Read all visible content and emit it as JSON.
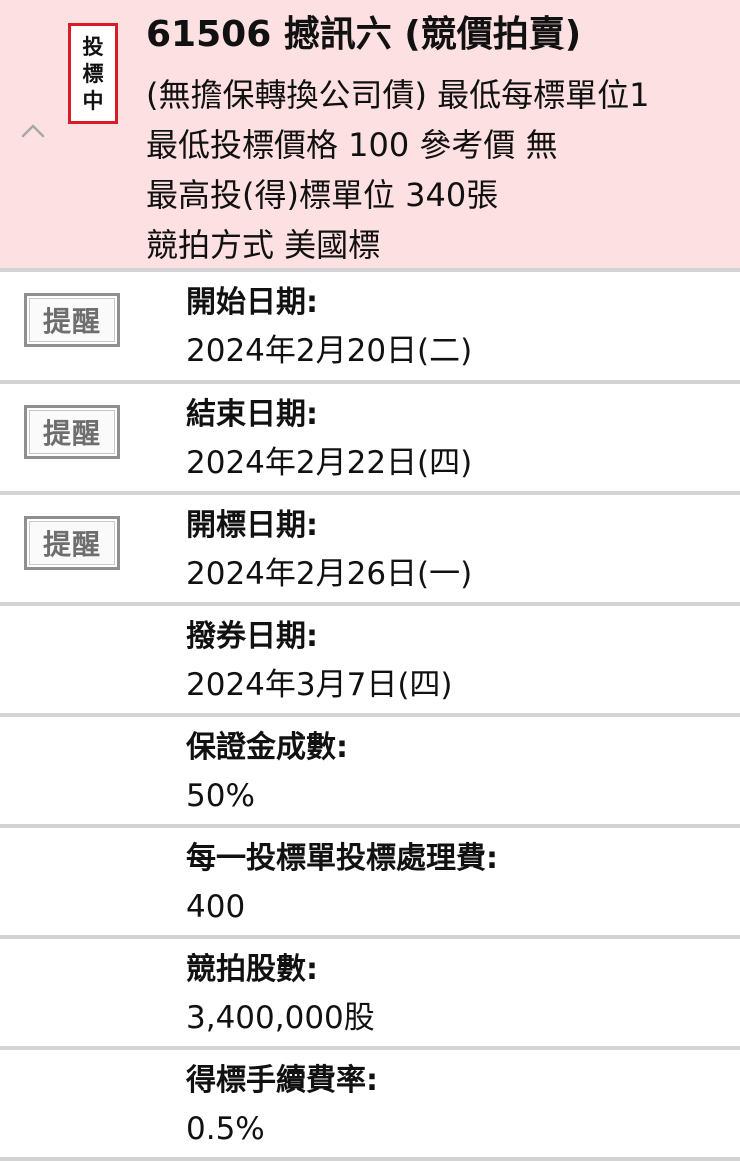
{
  "auction": {
    "status_stamp": [
      "投",
      "標",
      "中"
    ],
    "title": "61506 撼訊六 (競價拍賣)",
    "bond_type_line": "(無擔保轉換公司債) 最低每標單位1",
    "min_price_line": "最低投標價格 100 參考價 無",
    "max_units_line": "最高投(得)標單位 340張",
    "method_line": "競拍方式 美國標",
    "collapse_icon": "chevron-up-icon",
    "colors": {
      "header_bg": "#fde0e2",
      "stamp_border": "#d81d28"
    }
  },
  "remind_label": "提醒",
  "details": [
    {
      "label": "開始日期:",
      "value": "2024年2月20日(二)"
    },
    {
      "label": "結束日期:",
      "value": "2024年2月22日(四)"
    },
    {
      "label": "開標日期:",
      "value": "2024年2月26日(一)"
    },
    {
      "label": "撥券日期:",
      "value": "2024年3月7日(四)"
    },
    {
      "label": "保證金成數:",
      "value": "50%"
    },
    {
      "label": "每一投標單投標處理費:",
      "value": "400"
    },
    {
      "label": "競拍股數:",
      "value": "3,400,000股"
    },
    {
      "label": "得標手續費率:",
      "value": "0.5%"
    }
  ]
}
